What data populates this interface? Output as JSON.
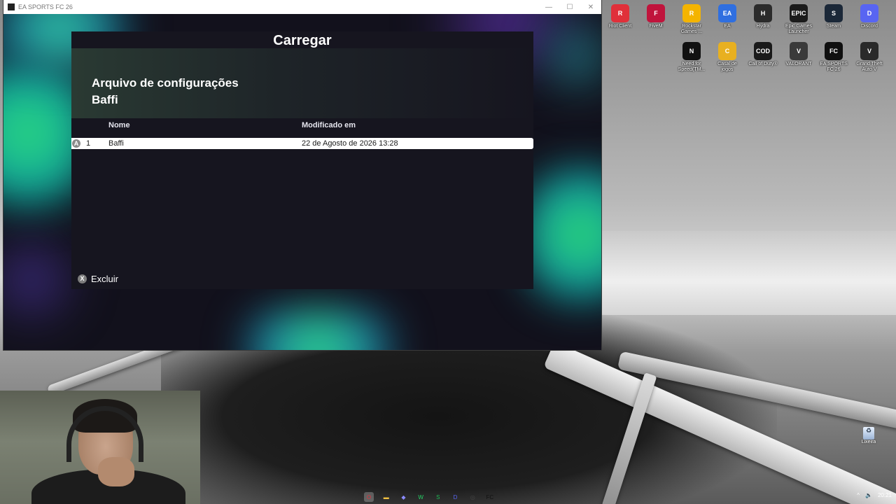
{
  "window": {
    "title": "EA SPORTS FC 26"
  },
  "dialog": {
    "title": "Carregar",
    "header_line1": "Arquivo de configurações",
    "header_line2": "Baffi",
    "columns": {
      "name": "Nome",
      "modified": "Modificado em"
    },
    "rows": [
      {
        "badge": "A",
        "index": "1",
        "name": "Baffi",
        "modified": "22 de Agosto de 2026 13:28"
      }
    ],
    "delete": {
      "badge": "X",
      "label": "Excluir"
    }
  },
  "desktop_icons": [
    {
      "name": "desktop-icon-riot-client",
      "label": "Riot Client",
      "glyph": "R",
      "color": "#e0303a"
    },
    {
      "name": "desktop-icon-fivem",
      "label": "FiveM",
      "glyph": "F",
      "color": "#c0143c"
    },
    {
      "name": "desktop-icon-rockstar",
      "label": "Rockstar Games ...",
      "glyph": "R",
      "color": "#f4b400"
    },
    {
      "name": "desktop-icon-ea",
      "label": "EA",
      "glyph": "EA",
      "color": "#2f6fe0"
    },
    {
      "name": "desktop-icon-hydra",
      "label": "Hydra",
      "glyph": "H",
      "color": "#2b2b2b"
    },
    {
      "name": "desktop-icon-epic",
      "label": "Epic Games Launcher",
      "glyph": "EPIC",
      "color": "#1b1b1b"
    },
    {
      "name": "desktop-icon-steam",
      "label": "Steam",
      "glyph": "S",
      "color": "#1b2838"
    },
    {
      "name": "desktop-icon-discord",
      "label": "Discord",
      "glyph": "D",
      "color": "#5865f2"
    },
    {
      "name": "desktop-icon-nfs",
      "label": "Need for Speed(TM...",
      "glyph": "N",
      "color": "#111111"
    },
    {
      "name": "desktop-icon-casal",
      "label": "Casal de jogos",
      "glyph": "C",
      "color": "#e8b020"
    },
    {
      "name": "desktop-icon-cod",
      "label": "Call of Duty®",
      "glyph": "COD",
      "color": "#1a1a1a"
    },
    {
      "name": "desktop-icon-valorant",
      "label": "VALORANT",
      "glyph": "V",
      "color": "#3a3a3a"
    },
    {
      "name": "desktop-icon-fc26",
      "label": "EA SPORTS FC 26",
      "glyph": "FC",
      "color": "#101010"
    },
    {
      "name": "desktop-icon-gta",
      "label": "Grand Theft Auto V",
      "glyph": "V",
      "color": "#2a2a2a"
    }
  ],
  "recycle_bin": {
    "label": "Lixeira"
  },
  "taskbar": {
    "icons": [
      {
        "name": "taskbar-opera-icon",
        "glyph": "O",
        "color": "#e0303a",
        "active": true
      },
      {
        "name": "taskbar-folder-icon",
        "glyph": "▬",
        "color": "#f0c040",
        "active": false
      },
      {
        "name": "taskbar-app-icon",
        "glyph": "◆",
        "color": "#8a8aff",
        "active": false
      },
      {
        "name": "taskbar-whatsapp-icon",
        "glyph": "W",
        "color": "#25d366",
        "active": false
      },
      {
        "name": "taskbar-spotify-icon",
        "glyph": "S",
        "color": "#1db954",
        "active": false
      },
      {
        "name": "taskbar-discord-icon",
        "glyph": "D",
        "color": "#5865f2",
        "active": false
      },
      {
        "name": "taskbar-obs-icon",
        "glyph": "◎",
        "color": "#444444",
        "active": false
      },
      {
        "name": "taskbar-fc26-icon",
        "glyph": "FC",
        "color": "#111111",
        "active": false
      }
    ],
    "clock": "20:21"
  }
}
